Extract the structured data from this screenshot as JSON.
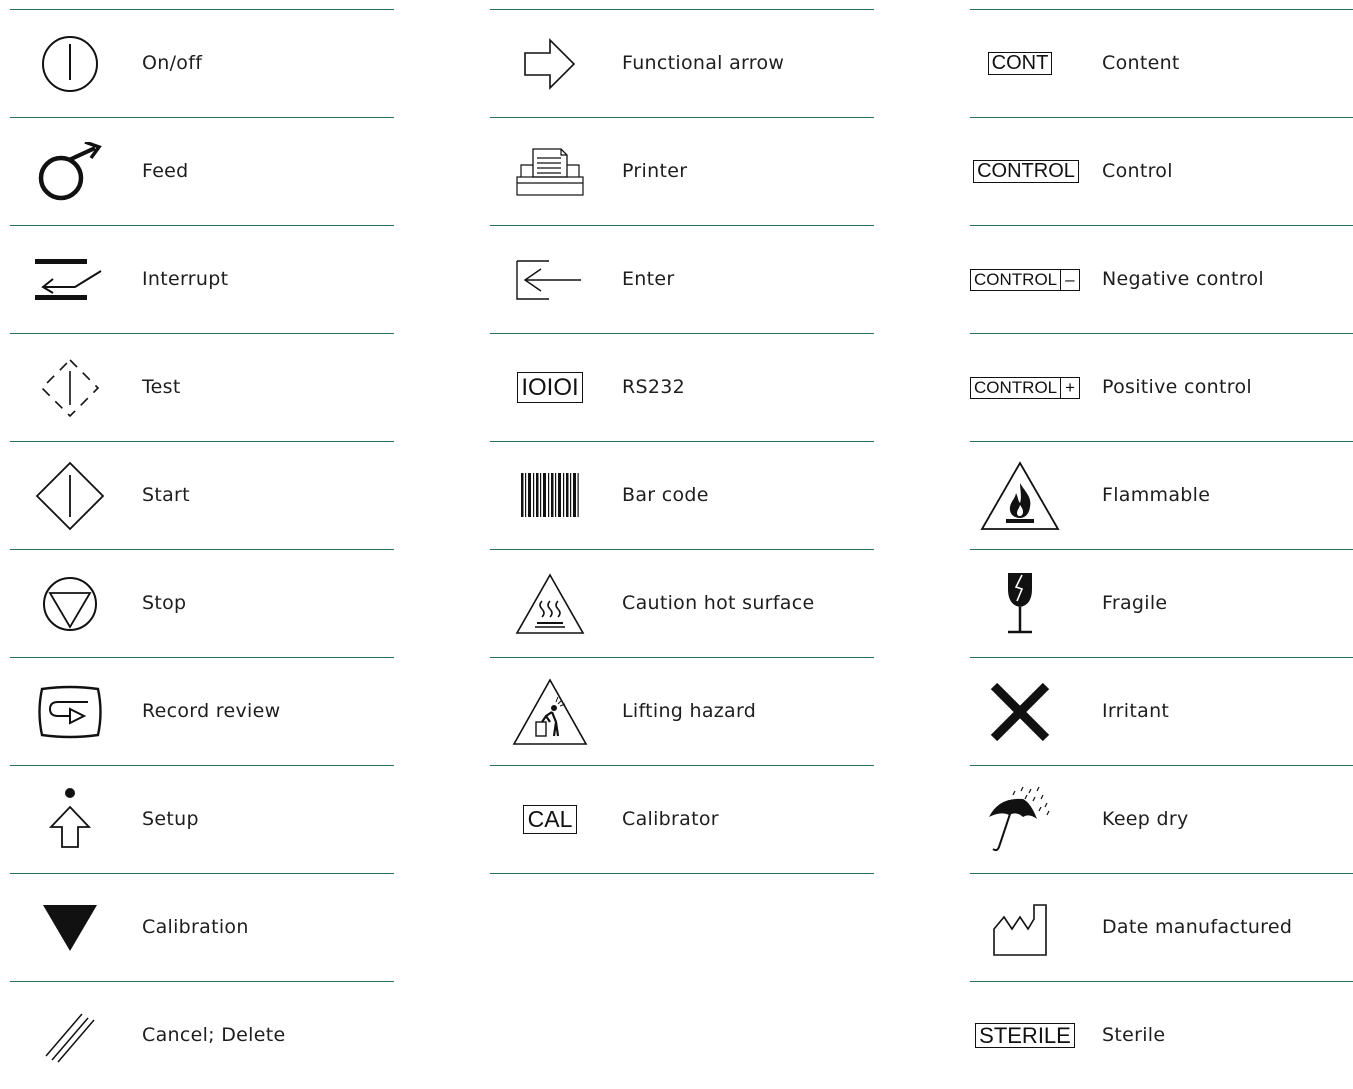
{
  "columns": [
    {
      "rows": [
        {
          "icon": "on-off-icon",
          "label": "On/off"
        },
        {
          "icon": "feed-icon",
          "label": "Feed"
        },
        {
          "icon": "interrupt-icon",
          "label": "Interrupt"
        },
        {
          "icon": "test-icon",
          "label": "Test"
        },
        {
          "icon": "start-icon",
          "label": "Start"
        },
        {
          "icon": "stop-icon",
          "label": "Stop"
        },
        {
          "icon": "record-review-icon",
          "label": "Record review"
        },
        {
          "icon": "setup-icon",
          "label": "Setup"
        },
        {
          "icon": "calibration-icon",
          "label": "Calibration"
        },
        {
          "icon": "cancel-delete-icon",
          "label": "Cancel; Delete"
        }
      ]
    },
    {
      "rows": [
        {
          "icon": "functional-arrow-icon",
          "label": "Functional arrow"
        },
        {
          "icon": "printer-icon",
          "label": "Printer"
        },
        {
          "icon": "enter-icon",
          "label": "Enter"
        },
        {
          "icon": "rs232-icon",
          "label": "RS232",
          "symbol_text": "IOIOI"
        },
        {
          "icon": "bar-code-icon",
          "label": "Bar code"
        },
        {
          "icon": "caution-hot-surface-icon",
          "label": "Caution hot surface"
        },
        {
          "icon": "lifting-hazard-icon",
          "label": "Lifting hazard"
        },
        {
          "icon": "calibrator-icon",
          "label": "Calibrator",
          "symbol_text": "CAL"
        }
      ]
    },
    {
      "rows": [
        {
          "icon": "content-icon",
          "label": "Content",
          "symbol_text": "CONT"
        },
        {
          "icon": "control-icon",
          "label": "Control",
          "symbol_text": "CONTROL"
        },
        {
          "icon": "negative-control-icon",
          "label": "Negative control",
          "symbol_text": "CONTROL",
          "symbol_sign": "–"
        },
        {
          "icon": "positive-control-icon",
          "label": "Positive control",
          "symbol_text": "CONTROL",
          "symbol_sign": "+"
        },
        {
          "icon": "flammable-icon",
          "label": "Flammable"
        },
        {
          "icon": "fragile-icon",
          "label": "Fragile"
        },
        {
          "icon": "irritant-icon",
          "label": "Irritant"
        },
        {
          "icon": "keep-dry-icon",
          "label": "Keep dry"
        },
        {
          "icon": "date-manufactured-icon",
          "label": "Date manufactured"
        },
        {
          "icon": "sterile-icon",
          "label": "Sterile",
          "symbol_text": "STERILE"
        }
      ]
    }
  ],
  "colors": {
    "rule": "#2e6e5c",
    "text": "#1e1e1e",
    "symbol": "#111111"
  }
}
